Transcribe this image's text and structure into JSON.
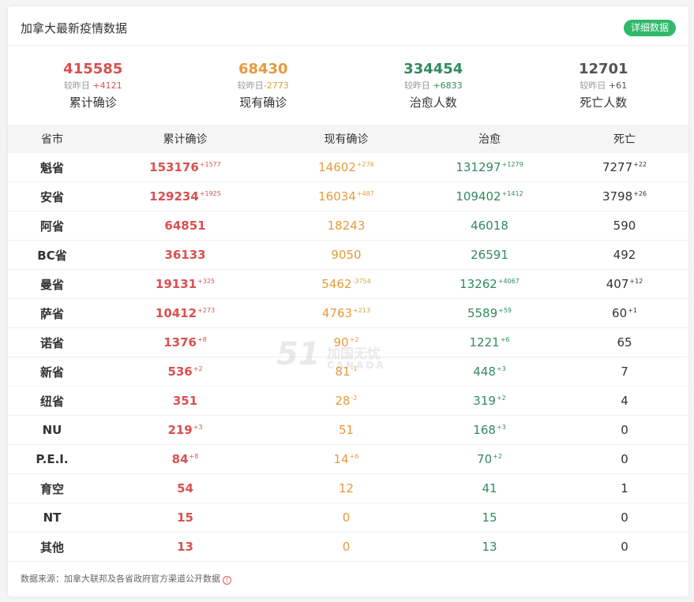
{
  "header": {
    "title": "加拿大最新疫情数据",
    "detail_button": "详细数据"
  },
  "colors": {
    "confirmed": "#d9504f",
    "active": "#e79a3d",
    "recovered": "#318a5f",
    "deaths": "#555555",
    "button": "#2fb96a"
  },
  "summary": [
    {
      "value": "415585",
      "delta_prefix": "较昨日",
      "delta": "+4121",
      "label": "累计确诊",
      "color": "#d9504f"
    },
    {
      "value": "68430",
      "delta_prefix": "较昨日",
      "delta": "-2773",
      "label": "现有确诊",
      "color": "#e79a3d"
    },
    {
      "value": "334454",
      "delta_prefix": "较昨日",
      "delta": "+6833",
      "label": "治愈人数",
      "color": "#318a5f"
    },
    {
      "value": "12701",
      "delta_prefix": "较昨日",
      "delta": "+61",
      "label": "死亡人数",
      "color": "#555555"
    }
  ],
  "table": {
    "headers": [
      "省市",
      "累计确诊",
      "现有确诊",
      "治愈",
      "死亡"
    ],
    "rows": [
      {
        "province": "魁省",
        "confirmed": "153176",
        "confirmed_delta": "+1577",
        "active": "14602",
        "active_delta": "+276",
        "recovered": "131297",
        "recovered_delta": "+1279",
        "deaths": "7277",
        "deaths_delta": "+22"
      },
      {
        "province": "安省",
        "confirmed": "129234",
        "confirmed_delta": "+1925",
        "active": "16034",
        "active_delta": "+487",
        "recovered": "109402",
        "recovered_delta": "+1412",
        "deaths": "3798",
        "deaths_delta": "+26"
      },
      {
        "province": "阿省",
        "confirmed": "64851",
        "confirmed_delta": "",
        "active": "18243",
        "active_delta": "",
        "recovered": "46018",
        "recovered_delta": "",
        "deaths": "590",
        "deaths_delta": ""
      },
      {
        "province": "BC省",
        "confirmed": "36133",
        "confirmed_delta": "",
        "active": "9050",
        "active_delta": "",
        "recovered": "26591",
        "recovered_delta": "",
        "deaths": "492",
        "deaths_delta": ""
      },
      {
        "province": "曼省",
        "confirmed": "19131",
        "confirmed_delta": "+325",
        "active": "5462",
        "active_delta": "-3754",
        "recovered": "13262",
        "recovered_delta": "+4067",
        "deaths": "407",
        "deaths_delta": "+12"
      },
      {
        "province": "萨省",
        "confirmed": "10412",
        "confirmed_delta": "+273",
        "active": "4763",
        "active_delta": "+213",
        "recovered": "5589",
        "recovered_delta": "+59",
        "deaths": "60",
        "deaths_delta": "+1"
      },
      {
        "province": "诺省",
        "confirmed": "1376",
        "confirmed_delta": "+8",
        "active": "90",
        "active_delta": "+2",
        "recovered": "1221",
        "recovered_delta": "+6",
        "deaths": "65",
        "deaths_delta": ""
      },
      {
        "province": "新省",
        "confirmed": "536",
        "confirmed_delta": "+2",
        "active": "81",
        "active_delta": "-1",
        "recovered": "448",
        "recovered_delta": "+3",
        "deaths": "7",
        "deaths_delta": ""
      },
      {
        "province": "纽省",
        "confirmed": "351",
        "confirmed_delta": "",
        "active": "28",
        "active_delta": "-2",
        "recovered": "319",
        "recovered_delta": "+2",
        "deaths": "4",
        "deaths_delta": ""
      },
      {
        "province": "NU",
        "confirmed": "219",
        "confirmed_delta": "+3",
        "active": "51",
        "active_delta": "",
        "recovered": "168",
        "recovered_delta": "+3",
        "deaths": "0",
        "deaths_delta": ""
      },
      {
        "province": "P.E.I.",
        "confirmed": "84",
        "confirmed_delta": "+8",
        "active": "14",
        "active_delta": "+6",
        "recovered": "70",
        "recovered_delta": "+2",
        "deaths": "0",
        "deaths_delta": ""
      },
      {
        "province": "育空",
        "confirmed": "54",
        "confirmed_delta": "",
        "active": "12",
        "active_delta": "",
        "recovered": "41",
        "recovered_delta": "",
        "deaths": "1",
        "deaths_delta": ""
      },
      {
        "province": "NT",
        "confirmed": "15",
        "confirmed_delta": "",
        "active": "0",
        "active_delta": "",
        "recovered": "15",
        "recovered_delta": "",
        "deaths": "0",
        "deaths_delta": ""
      },
      {
        "province": "其他",
        "confirmed": "13",
        "confirmed_delta": "",
        "active": "0",
        "active_delta": "",
        "recovered": "13",
        "recovered_delta": "",
        "deaths": "0",
        "deaths_delta": ""
      }
    ]
  },
  "footer": {
    "source": "数据来源：加拿大联邦及各省政府官方渠道公开数据",
    "info_icon": "!"
  },
  "watermark": {
    "number": "51",
    "text": "加国无忧",
    "sub": "CANADA"
  }
}
